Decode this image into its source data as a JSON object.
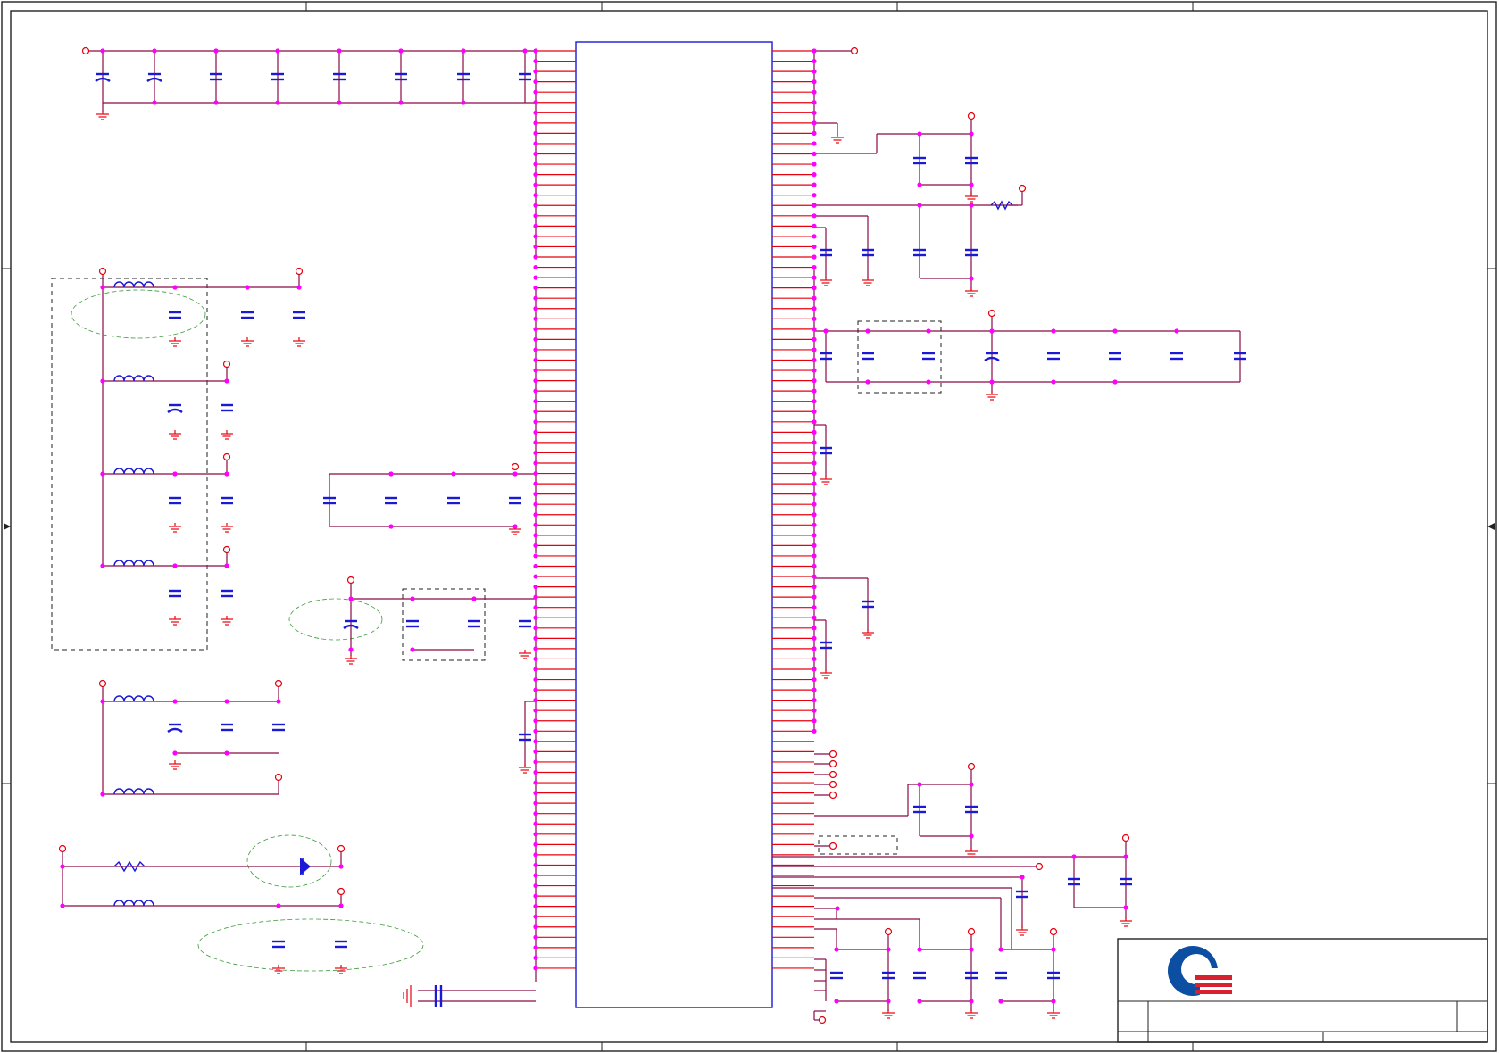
{
  "diagram": {
    "kind": "electrical-schematic",
    "colors": {
      "wire": "#8b0a46",
      "pin": "#e8000d",
      "component": "#1a1ad6",
      "junction": "#ff00ff",
      "annotation": "#3c9a3c",
      "logo_blue": "#0b4ea2",
      "logo_red": "#d8202f"
    },
    "icons": [
      "company-logo-icon",
      "capacitor-symbol",
      "inductor-symbol",
      "resistor-symbol",
      "diode-symbol",
      "ground-symbol",
      "off-page-port-symbol"
    ],
    "text": []
  }
}
